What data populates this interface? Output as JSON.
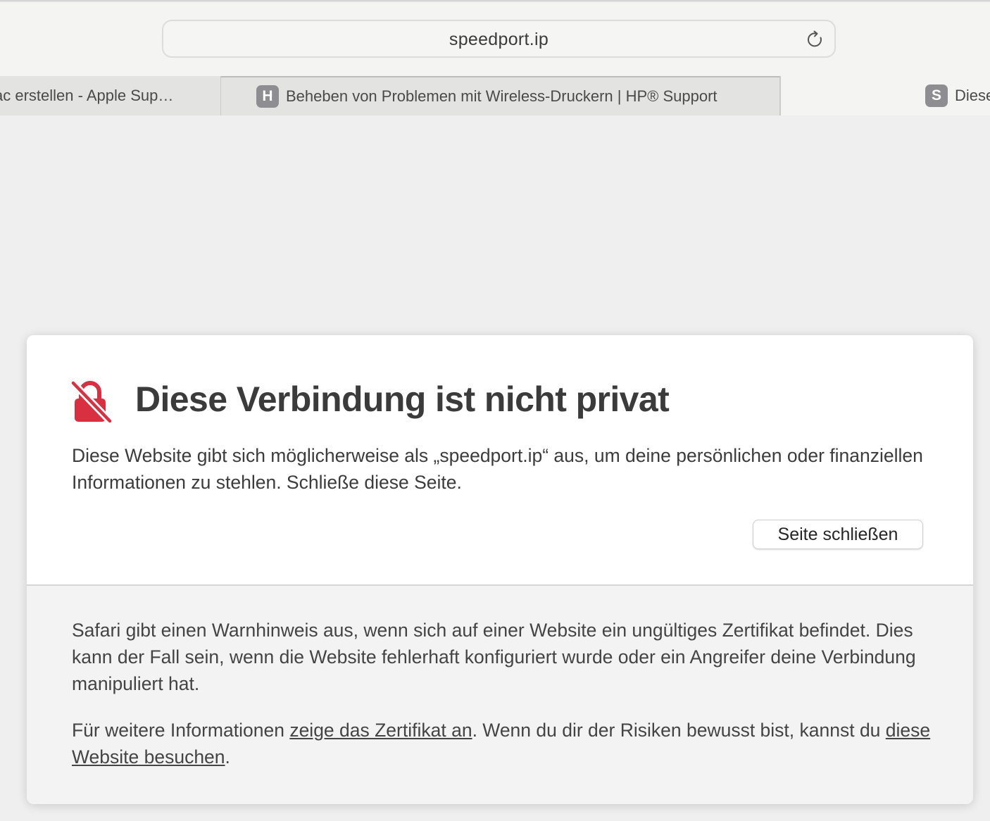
{
  "address_bar": {
    "url": "speedport.ip"
  },
  "tabs": [
    {
      "label": "ac erstellen - Apple Sup…",
      "favicon_letter": ""
    },
    {
      "label": "Beheben von Problemen mit Wireless-Druckern | HP® Support",
      "favicon_letter": "H"
    },
    {
      "label": "Diese",
      "favicon_letter": "S"
    }
  ],
  "warning": {
    "title": "Diese Verbindung ist nicht privat",
    "message": "Diese Website gibt sich möglicherweise als „speedport.ip“ aus, um deine persönlichen oder finanziellen Informationen zu stehlen. Schließe diese Seite.",
    "close_button_label": "Seite schließen",
    "icon": "lock-slash-icon",
    "icon_color": "#d83041"
  },
  "details": {
    "paragraph1": "Safari gibt einen Warnhinweis aus, wenn sich auf einer Website ein ungültiges Zertifikat befindet. Dies kann der Fall sein, wenn die Website fehlerhaft konfiguriert wurde oder ein Angreifer deine Verbindung manipuliert hat.",
    "paragraph2_prefix": "Für weitere Informationen ",
    "certificate_link": "zeige das Zertifikat an",
    "paragraph2_middle": ". Wenn du dir der Risiken bewusst bist, kannst du ",
    "visit_link": "diese Website besuchen",
    "paragraph2_suffix": "."
  }
}
